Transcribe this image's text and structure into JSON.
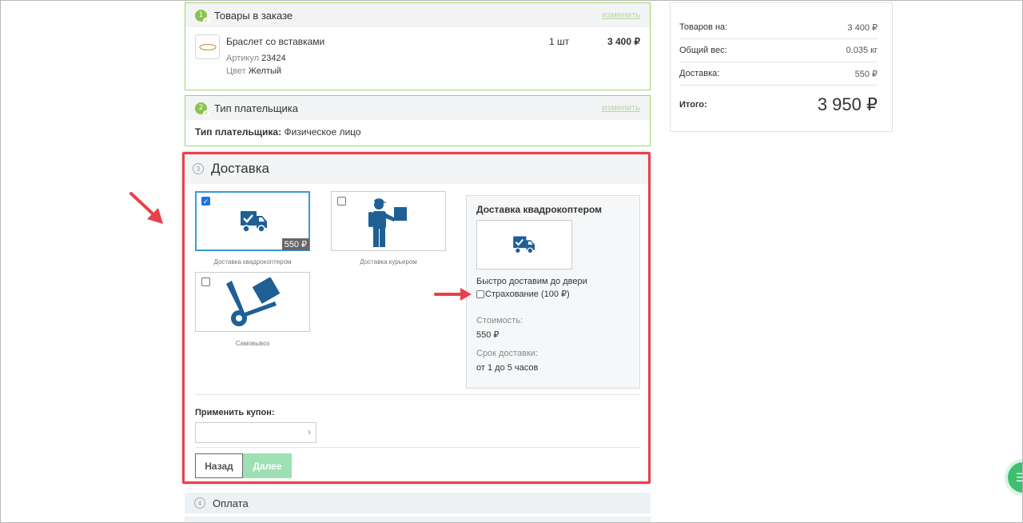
{
  "colors": {
    "accent_green": "#8bc34a",
    "blue_icon": "#1e5f96",
    "selected_border": "#3a9ad9",
    "highlight_red": "#e8414b",
    "next_button": "#9ce0b3"
  },
  "step1": {
    "number": "1",
    "title": "Товары в заказе",
    "change": "изменить",
    "item": {
      "name": "Браслет со вставками",
      "article_label": "Артикул",
      "article_value": "23424",
      "color_label": "Цвет",
      "color_value": "Желтый",
      "qty": "1 шт",
      "price": "3 400 ₽"
    }
  },
  "step2": {
    "number": "2",
    "title": "Тип плательщика",
    "change": "изменить",
    "payer_label": "Тип плательщика:",
    "payer_value": "Физическое лицо"
  },
  "step3": {
    "number": "3",
    "title": "Доставка",
    "options": [
      {
        "label": "Доставка квадрокоптером",
        "price": "550 ₽",
        "selected": true,
        "icon": "delivery-truck-icon"
      },
      {
        "label": "Доставка курьером",
        "selected": false,
        "icon": "courier-icon"
      },
      {
        "label": "Самовывоз",
        "selected": false,
        "icon": "hand-truck-icon"
      }
    ],
    "info": {
      "title": "Доставка квадрокоптером",
      "description": "Быстро доставим до двери",
      "insurance": "Страхование (100 ₽)",
      "cost_label": "Стоимость:",
      "cost_value": "550 ₽",
      "time_label": "Срок доставки:",
      "time_value": "от 1 до 5 часов"
    },
    "coupon_label": "Применить купон:",
    "coupon_arrow": "›",
    "back_button": "Назад",
    "next_button": "Далее"
  },
  "step4": {
    "number": "4",
    "title": "Оплата"
  },
  "summary": {
    "rows": [
      {
        "label": "Товаров на:",
        "value": "3 400 ₽"
      },
      {
        "label": "Общий вес:",
        "value": "0.035 кг"
      },
      {
        "label": "Доставка:",
        "value": "550 ₽"
      }
    ],
    "total_label": "Итого:",
    "total_value": "3 950 ₽"
  }
}
